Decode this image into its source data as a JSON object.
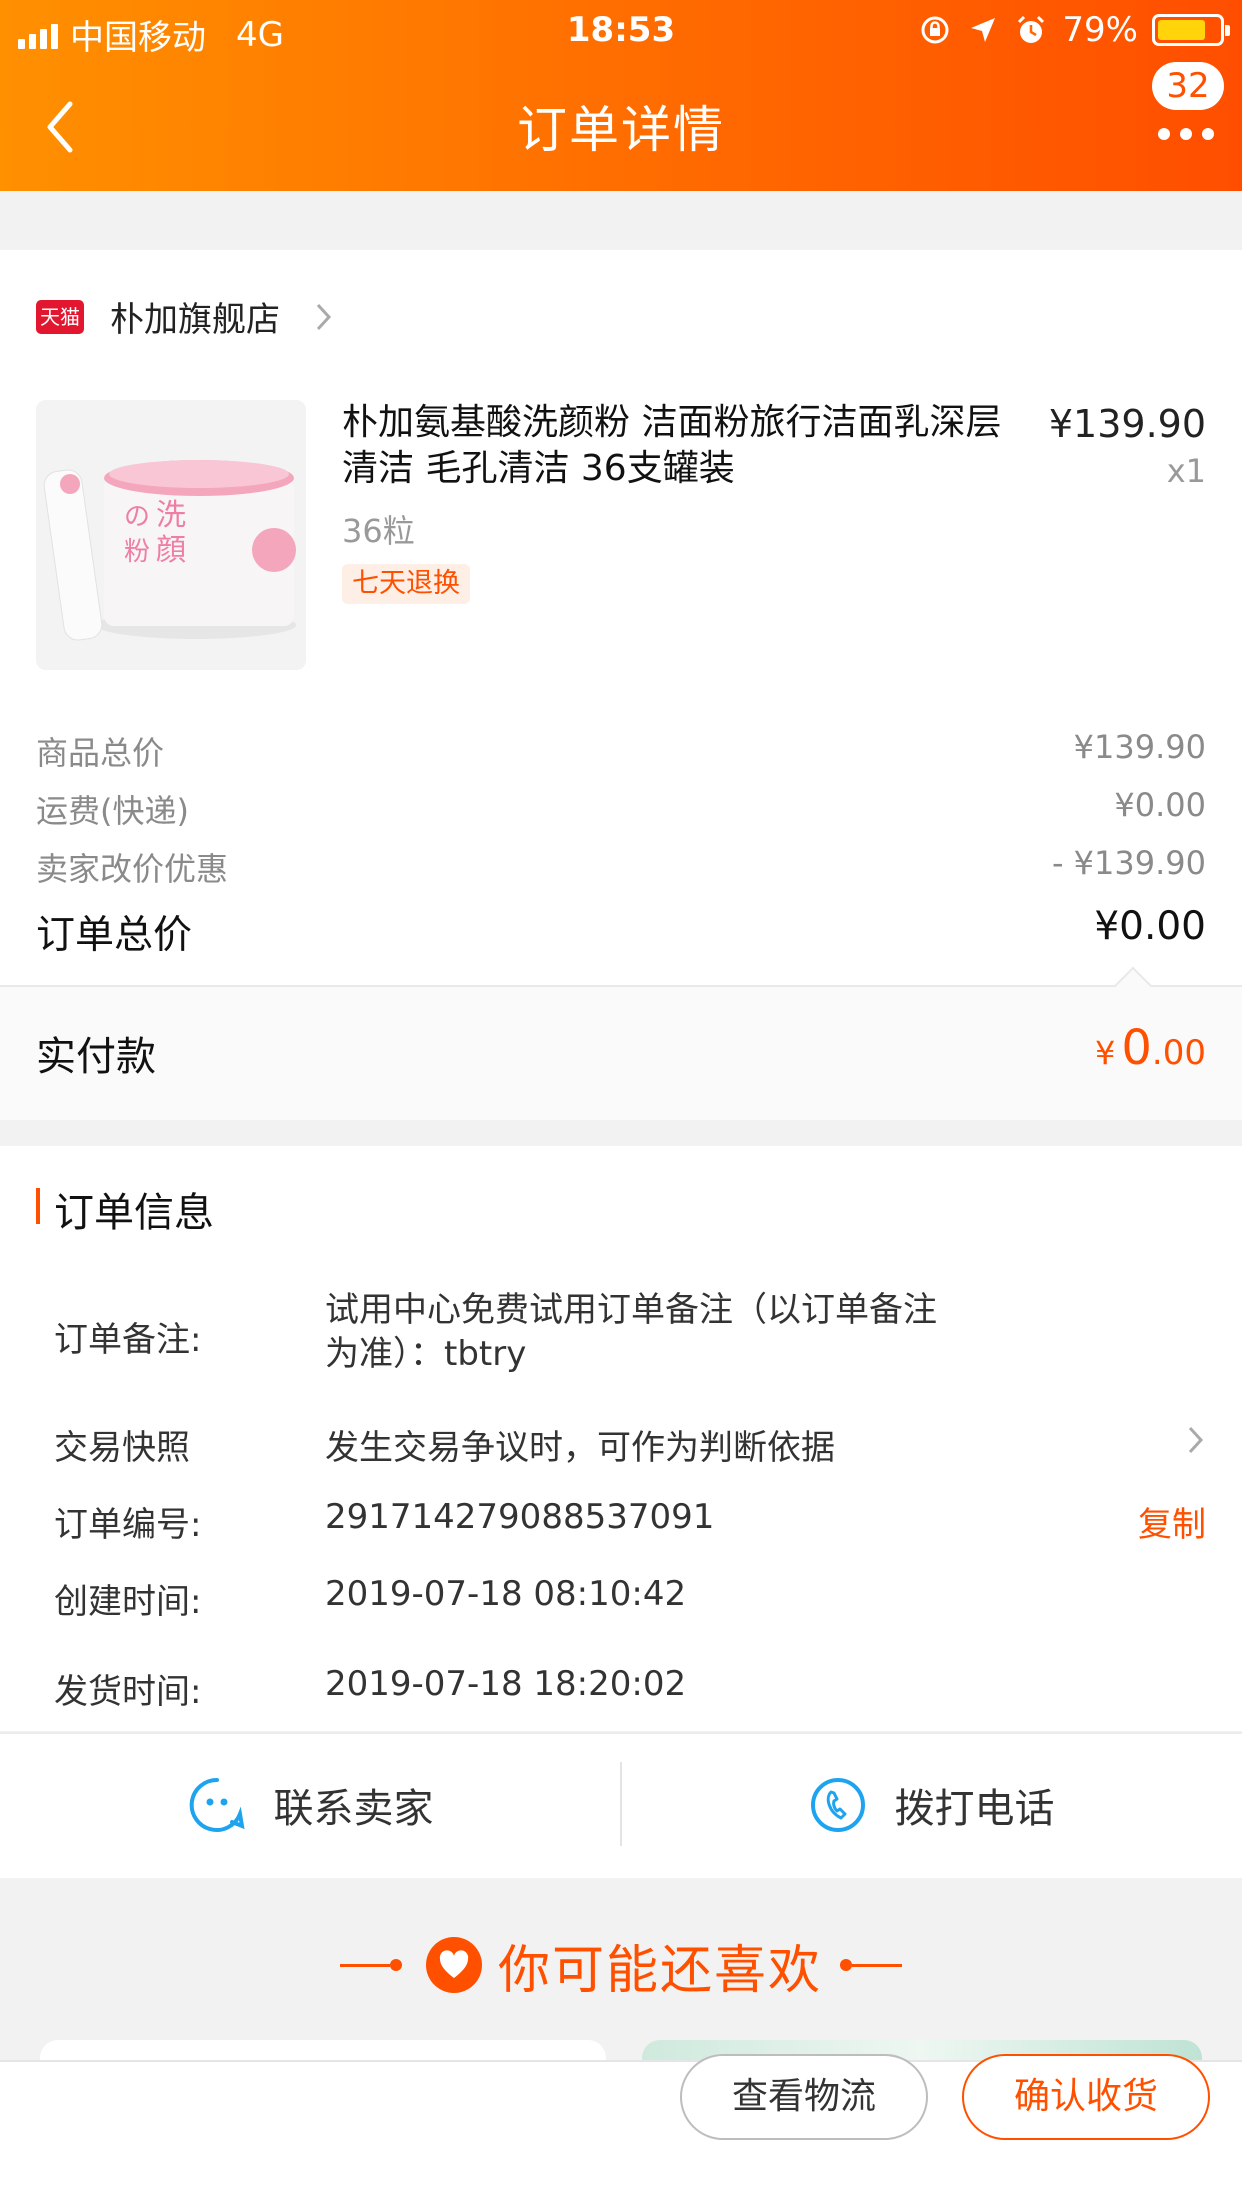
{
  "status_bar": {
    "carrier": "中国移动",
    "network": "4G",
    "time": "18:53",
    "battery": "79%",
    "battery_level": 0.79
  },
  "nav": {
    "title": "订单详情",
    "badge_count": "32"
  },
  "store": {
    "logo_text": "天猫",
    "name": "朴加旗舰店"
  },
  "product": {
    "title": "朴加氨基酸洗颜粉 洁面粉旅行洁面乳深层清洁 毛孔清洁 36支罐装",
    "price": "¥139.90",
    "quantity": "x1",
    "sku": "36粒",
    "tag": "七天退换",
    "image_text": "洗顔の粉"
  },
  "fees": [
    {
      "label": "商品总价",
      "value": "¥139.90"
    },
    {
      "label": "运费(快递)",
      "value": "¥0.00"
    },
    {
      "label": "卖家改价优惠",
      "value": "- ¥139.90"
    }
  ],
  "order_total": {
    "label": "订单总价",
    "value": "¥0.00"
  },
  "paid": {
    "label": "实付款",
    "currency": "¥",
    "integer": "0",
    "decimal": ".00"
  },
  "order_info": {
    "heading": "订单信息",
    "note_label": "订单备注:",
    "note_line1": "试用中心免费试用订单备注（以订单备注",
    "note_line2": "为准）：tbtry",
    "snapshot_label": "交易快照",
    "snapshot_value": "发生交易争议时，可作为判断依据",
    "order_no_label": "订单编号:",
    "order_no": "2917142790885370​91",
    "copy_label": "复制",
    "created_label": "创建时间:",
    "created_value": "2019-07-18 08:10:42",
    "shipped_label": "发货时间:",
    "shipped_value": "2019-07-18 18:20:02"
  },
  "contact": {
    "seller_label": "联系卖家",
    "phone_label": "拨打电话"
  },
  "recommend": {
    "title": "你可能还喜欢"
  },
  "actions": {
    "logistics": "查看物流",
    "confirm": "确认收货"
  },
  "colors": {
    "accent": "#ff5000",
    "header_start": "#ff9000",
    "header_end": "#ff4e00",
    "tmall_red": "#e2162f"
  },
  "icons": [
    "back-arrow-icon",
    "more-dots-icon",
    "chevron-right-icon",
    "chat-face-icon",
    "phone-icon",
    "heart-icon",
    "rotation-lock-icon",
    "location-arrow-icon",
    "alarm-icon"
  ]
}
